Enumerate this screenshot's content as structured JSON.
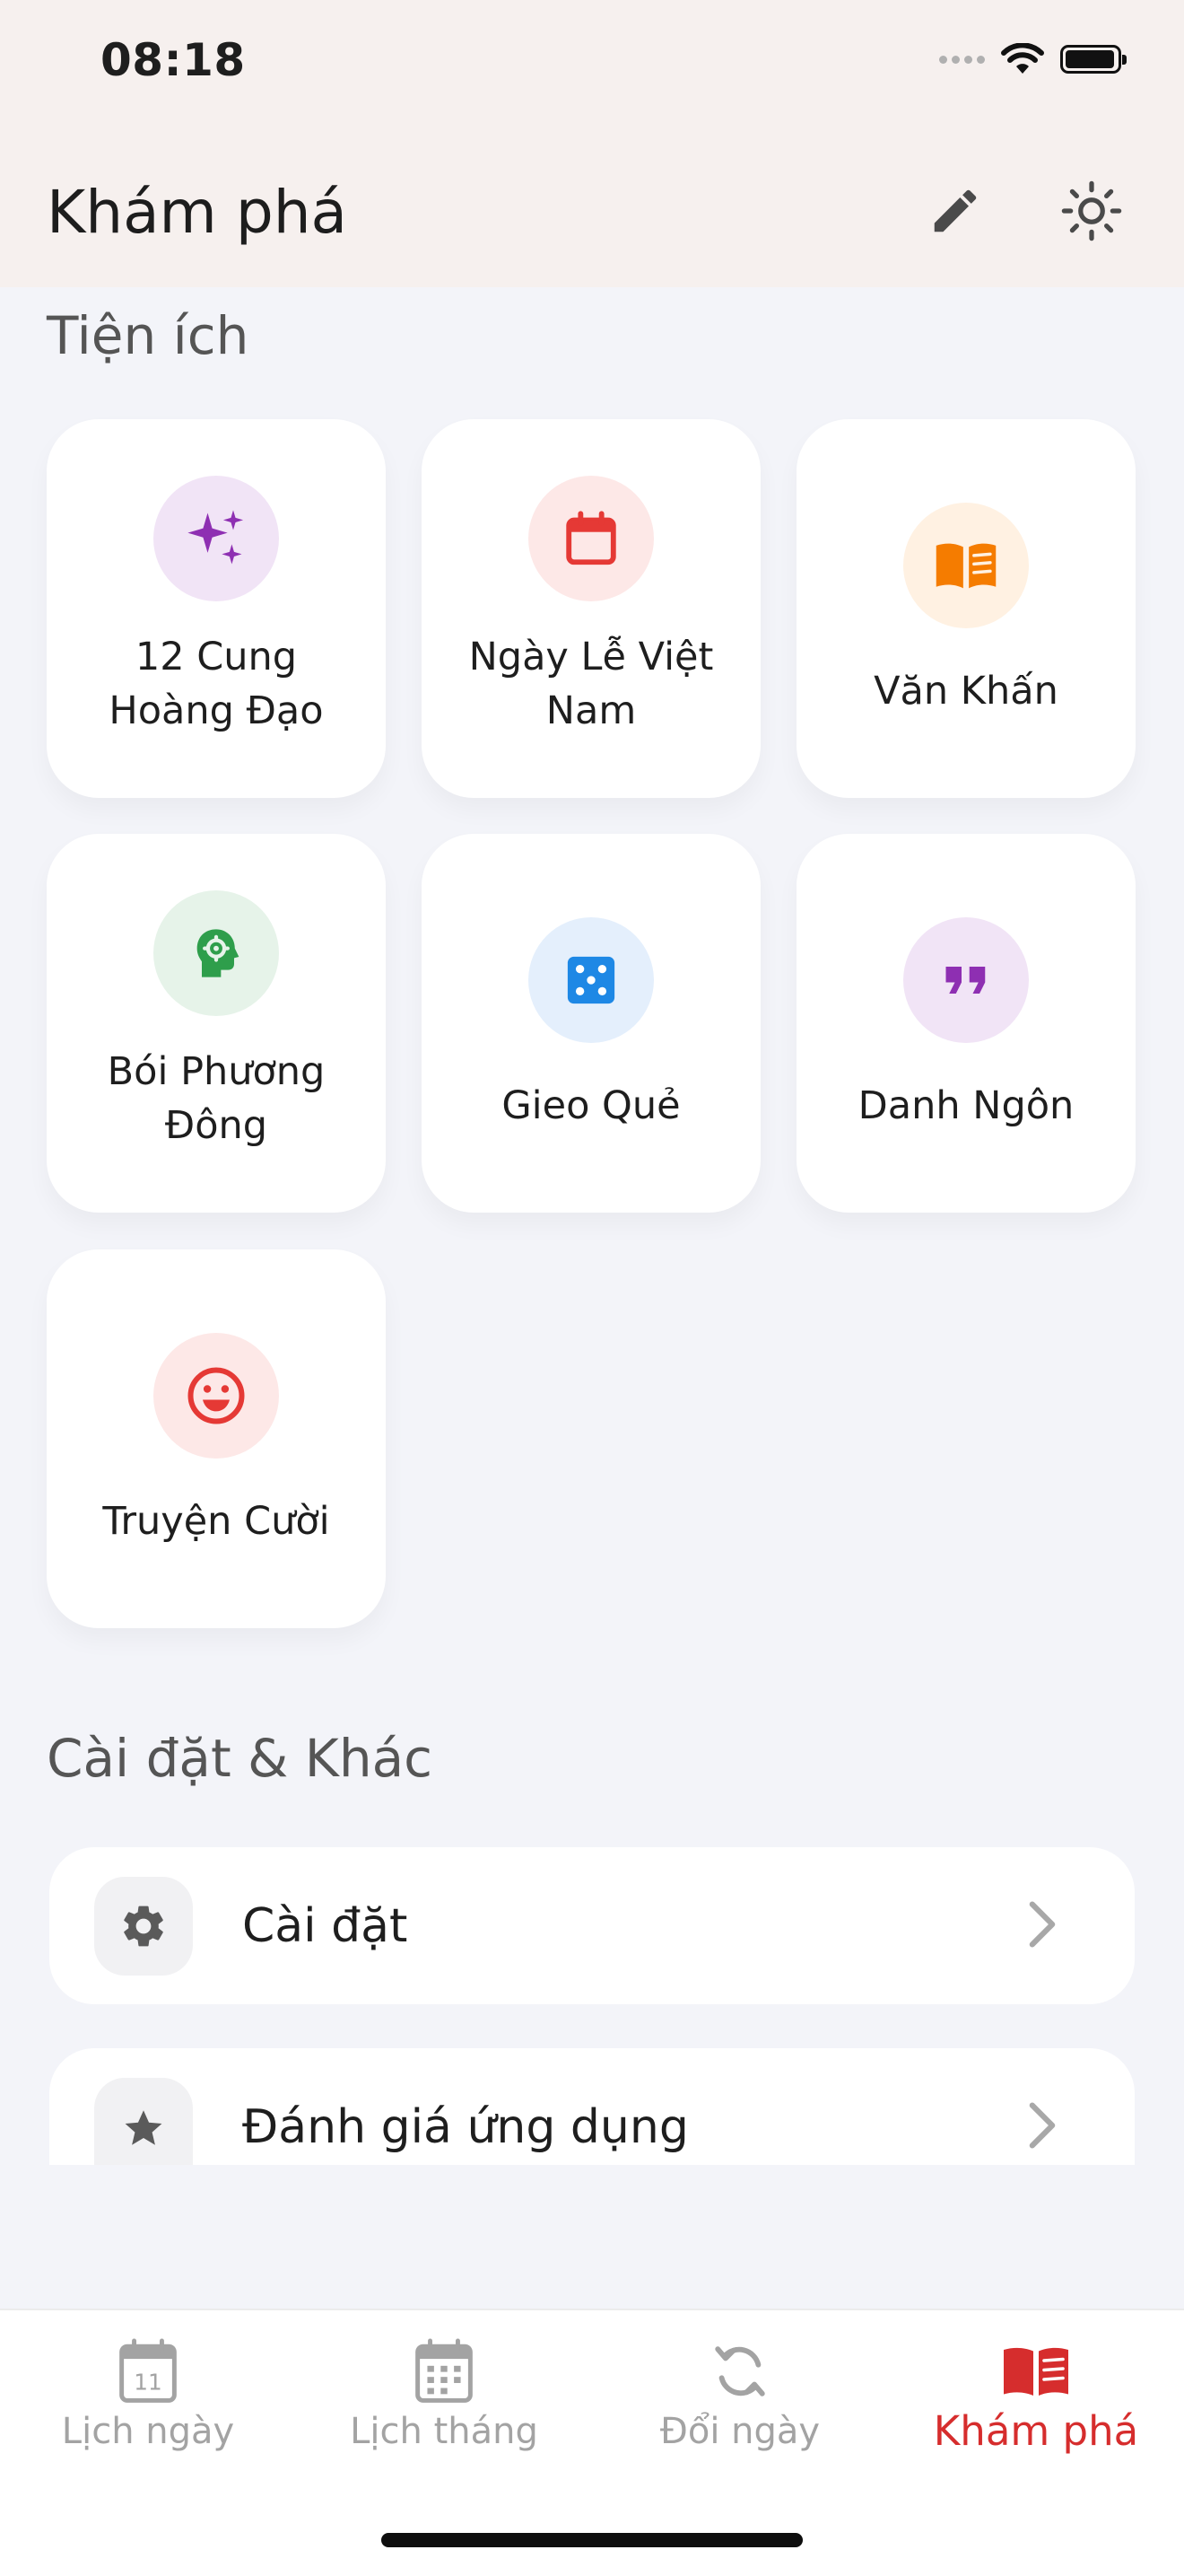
{
  "status_bar": {
    "time": "08:18",
    "icons": [
      "cellular-signal-icon",
      "wifi-icon",
      "battery-icon"
    ]
  },
  "header": {
    "title": "Khám phá",
    "actions": [
      "pencil-icon",
      "sun-icon"
    ]
  },
  "utilities": {
    "section_title": "Tiện ích",
    "tiles": [
      {
        "label": "12 Cung Hoàng Đạo",
        "icon": "sparkles-icon",
        "color": "#8e2fb2",
        "bg": "#f1e4f6"
      },
      {
        "label": "Ngày Lễ Việt Nam",
        "icon": "calendar-icon",
        "color": "#e53935",
        "bg": "#fde8e7"
      },
      {
        "label": "Văn Khấn",
        "icon": "open-book-icon",
        "color": "#f57c00",
        "bg": "#fff1e2"
      },
      {
        "label": "Bói Phương Đông",
        "icon": "head-gear-icon",
        "color": "#2e9e4b",
        "bg": "#e6f3e9"
      },
      {
        "label": "Gieo Quẻ",
        "icon": "dice-icon",
        "color": "#1e88e5",
        "bg": "#e4effc"
      },
      {
        "label": "Danh Ngôn",
        "icon": "quote-icon",
        "color": "#8e2fb2",
        "bg": "#f1e4f6"
      },
      {
        "label": "Truyện Cười",
        "icon": "smiley-icon",
        "color": "#e53935",
        "bg": "#fde8e7"
      }
    ]
  },
  "settings": {
    "section_title": "Cài đặt & Khác",
    "items": [
      {
        "label": "Cài đặt",
        "icon": "gear-icon"
      },
      {
        "label": "Đánh giá ứng dụng",
        "icon": "star-icon"
      }
    ]
  },
  "bottom_nav": {
    "items": [
      {
        "label": "Lịch ngày",
        "icon": "day-calendar-icon",
        "day_number": "11",
        "active": false
      },
      {
        "label": "Lịch tháng",
        "icon": "month-calendar-icon",
        "active": false
      },
      {
        "label": "Đổi ngày",
        "icon": "sync-icon",
        "active": false
      },
      {
        "label": "Khám phá",
        "icon": "book-icon",
        "active": true
      }
    ],
    "active_color": "#d62d2d",
    "inactive_color": "#a3a3a3"
  }
}
